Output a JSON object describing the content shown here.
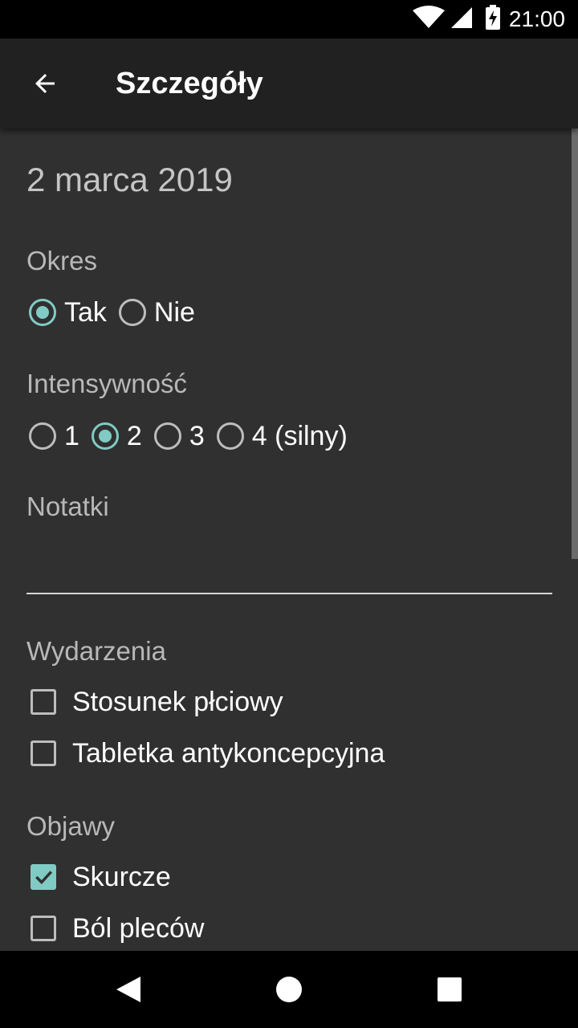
{
  "status_bar": {
    "time": "21:00",
    "icons": [
      "wifi-icon",
      "signal-icon",
      "battery-charging-icon"
    ]
  },
  "app_bar": {
    "title": "Szczegóły",
    "back_icon": "arrow-left-icon"
  },
  "details": {
    "date": "2 marca 2019",
    "period": {
      "label": "Okres",
      "options": [
        {
          "label": "Tak",
          "selected": true
        },
        {
          "label": "Nie",
          "selected": false
        }
      ]
    },
    "intensity": {
      "label": "Intensywność",
      "options": [
        {
          "label": "1",
          "selected": false
        },
        {
          "label": "2",
          "selected": true
        },
        {
          "label": "3",
          "selected": false
        },
        {
          "label": "4 (silny)",
          "selected": false
        }
      ]
    },
    "notes": {
      "label": "Notatki",
      "value": ""
    },
    "events": {
      "label": "Wydarzenia",
      "items": [
        {
          "label": "Stosunek płciowy",
          "checked": false
        },
        {
          "label": "Tabletka antykoncepcyjna",
          "checked": false
        }
      ]
    },
    "symptoms": {
      "label": "Objawy",
      "items": [
        {
          "label": "Skurcze",
          "checked": true
        },
        {
          "label": "Ból pleców",
          "checked": false
        }
      ]
    }
  },
  "nav_bar": {
    "icons": [
      "back-triangle-icon",
      "home-circle-icon",
      "recents-square-icon"
    ]
  },
  "colors": {
    "accent": "#80cbc4",
    "background": "#303030",
    "app_bar": "#212121"
  }
}
